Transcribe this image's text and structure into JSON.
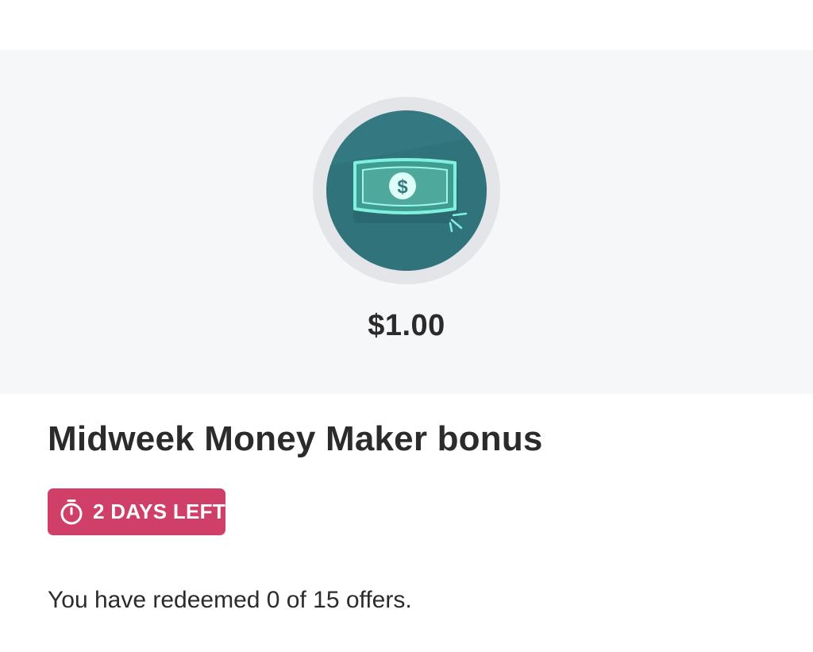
{
  "reward": {
    "amount": "$1.00",
    "icon": "cash-bill-icon",
    "badge_color": "#347981",
    "bill_color": "#4fa89c",
    "glow_color": "#7ff1de"
  },
  "offer": {
    "title": "Midweek Money Maker bonus",
    "time_left_label": "2 DAYS LEFT",
    "time_left_icon": "stopwatch-icon",
    "pill_color": "#cf3f68",
    "redeemed_text": "You have redeemed 0 of 15 offers."
  }
}
